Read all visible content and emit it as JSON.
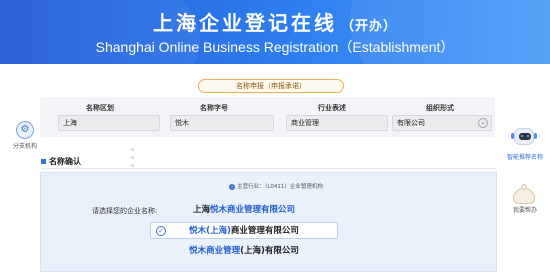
{
  "header": {
    "title": "上海企业登记在线",
    "title_sub": "（开办）",
    "subtitle": "Shanghai Online Business Registration（Establishment）"
  },
  "name_declaration": {
    "pill_label": "名称申报（申报承诺）",
    "fields": [
      {
        "label": "名称区划",
        "value": "上海"
      },
      {
        "label": "名称字号",
        "value": "悦木"
      },
      {
        "label": "行业表述",
        "value": "商业管理"
      },
      {
        "label": "组织形式",
        "value": "有限公司"
      }
    ],
    "select_icon": "chevron-down-icon"
  },
  "left_rail": {
    "icon": "gear-icon",
    "label": "分支机构"
  },
  "result": {
    "section_title": "名称确认",
    "hint": "主营行业：（L0411）企业管理机构",
    "hint_icon": "info-icon",
    "prompt": "请选择您的企业名称:",
    "options": [
      {
        "prefix": "上海",
        "highlight": "悦木商业管理有限公司",
        "suffix": "",
        "selected": false
      },
      {
        "prefix": "",
        "highlight": "悦木(上海)",
        "suffix": "商业管理有限公司",
        "selected": true
      },
      {
        "prefix": "",
        "highlight": "悦木商业管理",
        "suffix": "(上海)有限公司",
        "selected": false
      }
    ]
  },
  "right_rail": {
    "assistant_label": "智能推荐名称",
    "assistant_icon": "robot-icon",
    "help_label": "我要帮办",
    "help_icon": "bun-mascot-icon"
  },
  "colors": {
    "brand": "#2f7ff0",
    "highlight": "#1f5fcf",
    "pill_border": "#e6b35a"
  }
}
